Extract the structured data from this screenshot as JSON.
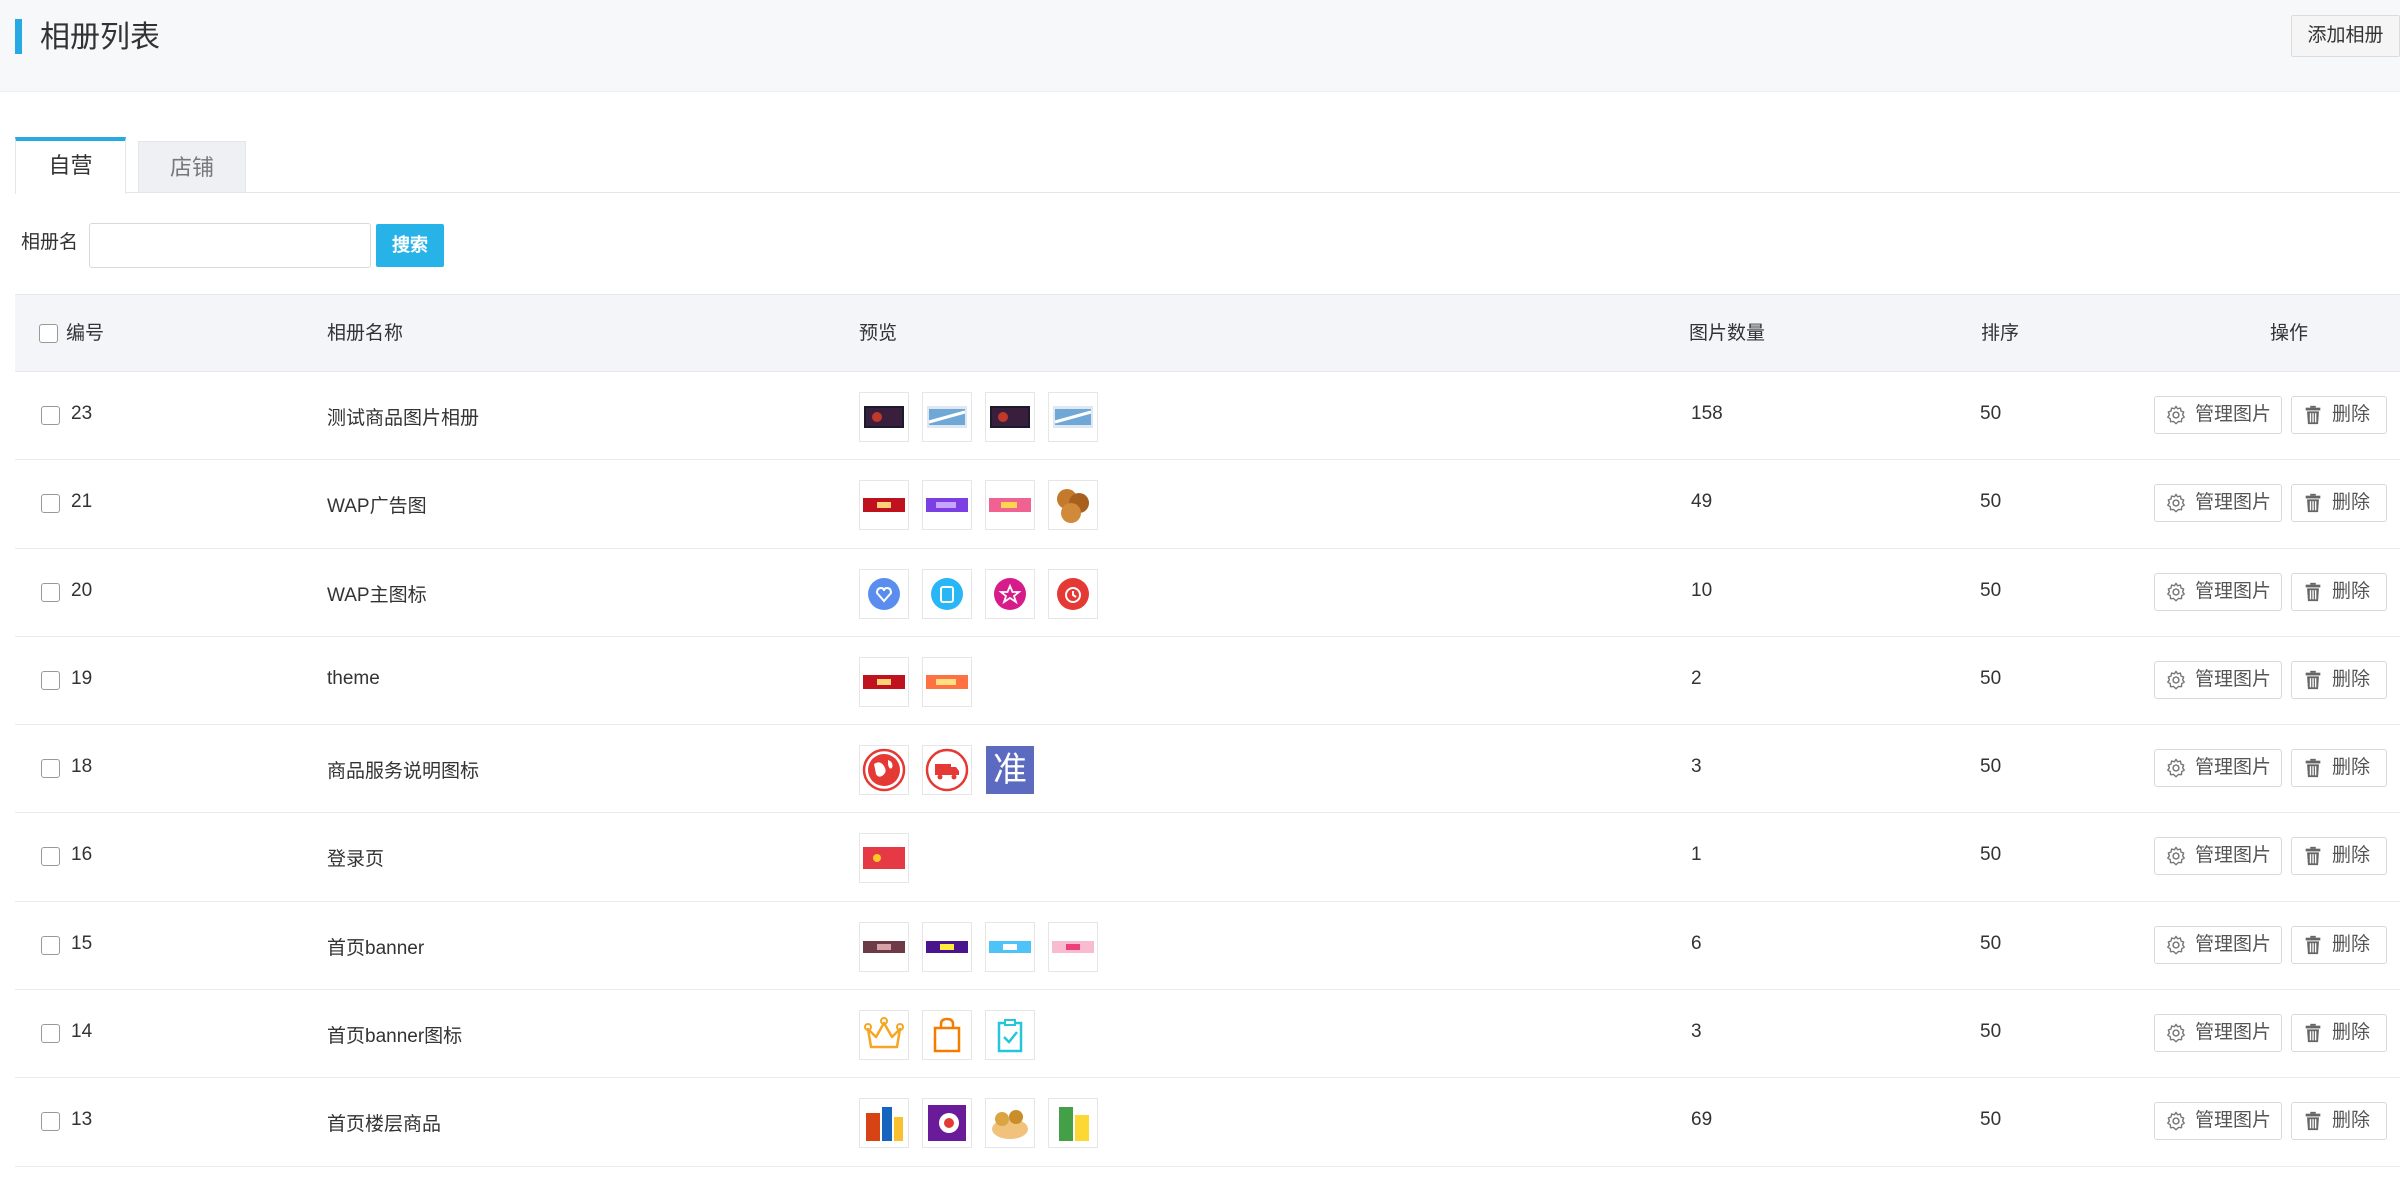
{
  "header": {
    "title": "相册列表",
    "add_button": "添加相册"
  },
  "tabs": [
    {
      "label": "自营",
      "active": true
    },
    {
      "label": "店铺",
      "active": false
    }
  ],
  "search": {
    "label": "相册名",
    "value": "",
    "placeholder": "",
    "button": "搜索"
  },
  "table": {
    "headers": {
      "id": "编号",
      "name": "相册名称",
      "preview": "预览",
      "count": "图片数量",
      "sort": "排序",
      "actions": "操作"
    },
    "actions": {
      "manage": "管理图片",
      "delete": "删除"
    },
    "rows": [
      {
        "id": "23",
        "name": "测试商品图片相册",
        "count": "158",
        "sort": "50",
        "thumbs": [
          "tv-dark",
          "tv-light",
          "tv-dark",
          "tv-light"
        ]
      },
      {
        "id": "21",
        "name": "WAP广告图",
        "count": "49",
        "sort": "50",
        "thumbs": [
          "banner-red",
          "banner-purple",
          "banner-pink",
          "food-walnut"
        ]
      },
      {
        "id": "20",
        "name": "WAP主图标",
        "count": "10",
        "sort": "50",
        "thumbs": [
          "icon-blue-heart",
          "icon-blue-clip",
          "icon-pink-star",
          "icon-red-clock"
        ]
      },
      {
        "id": "19",
        "name": "theme",
        "count": "2",
        "sort": "50",
        "thumbs": [
          "banner-red",
          "banner-orange"
        ]
      },
      {
        "id": "18",
        "name": "商品服务说明图标",
        "count": "3",
        "sort": "50",
        "thumbs": [
          "globe-icon",
          "truck-icon",
          "zhun-icon"
        ]
      },
      {
        "id": "16",
        "name": "登录页",
        "count": "1",
        "sort": "50",
        "thumbs": [
          "banner-crimson"
        ]
      },
      {
        "id": "15",
        "name": "首页banner",
        "count": "6",
        "sort": "50",
        "thumbs": [
          "banner-brown",
          "banner-violet",
          "banner-sky",
          "banner-rose"
        ]
      },
      {
        "id": "14",
        "name": "首页banner图标",
        "count": "3",
        "sort": "50",
        "thumbs": [
          "crown-icon",
          "bag-icon",
          "clipboard-check-icon"
        ]
      },
      {
        "id": "13",
        "name": "首页楼层商品",
        "count": "69",
        "sort": "50",
        "thumbs": [
          "food-1",
          "food-2",
          "food-3",
          "food-4"
        ]
      }
    ],
    "special_glyph": "准"
  },
  "colors": {
    "accent": "#27a9e3",
    "search_button": "#27b3e8"
  }
}
